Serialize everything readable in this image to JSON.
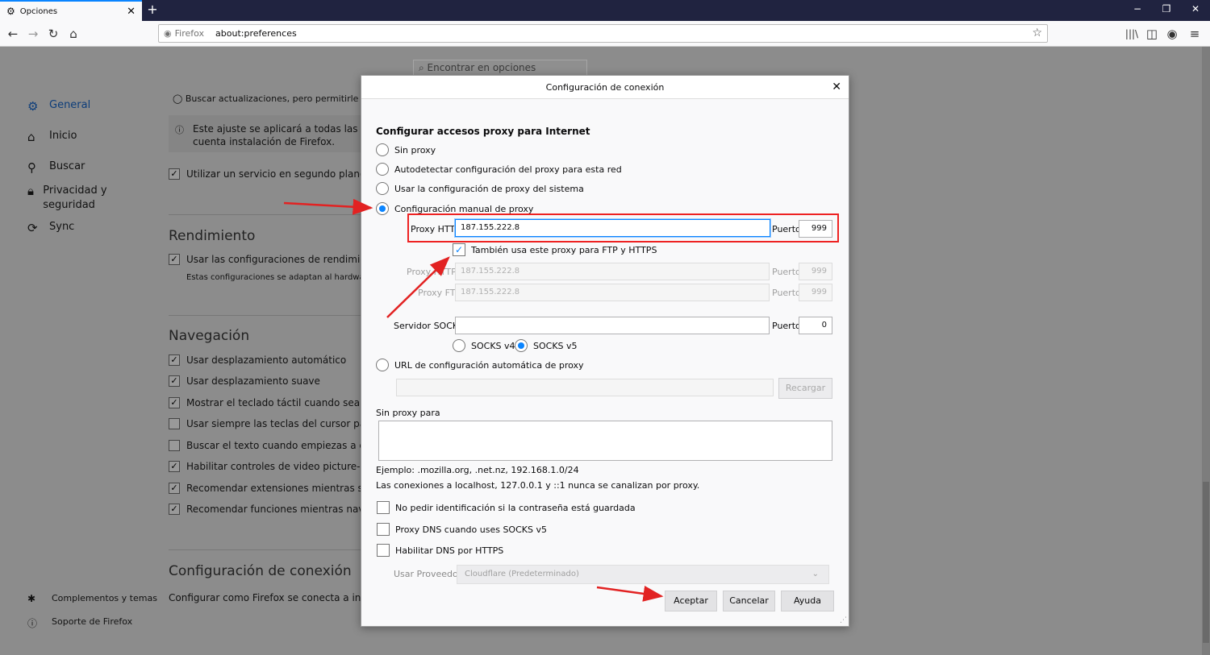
{
  "browser": {
    "tab_title": "Opciones",
    "tab_close": "✕",
    "new_tab": "+",
    "identity_label": "Firefox",
    "url": "about:preferences",
    "window_minimize": "−",
    "window_restore": "❐",
    "window_close": "✕"
  },
  "prefs": {
    "search_placeholder": "Encontrar en opciones",
    "sidebar": [
      {
        "label": "General"
      },
      {
        "label": "Inicio"
      },
      {
        "label": "Buscar"
      },
      {
        "label": "Privacidad y seguridad"
      },
      {
        "label": "Sync"
      }
    ],
    "footer_links": [
      {
        "label": "Complementos y temas"
      },
      {
        "label": "Soporte de Firefox"
      }
    ],
    "update_option": "Buscar actualizaciones, pero permitirle e",
    "update_info": "Este ajuste se aplicará a todas las cuenta instalación de Firefox.",
    "background_service": "Utilizar un servicio en segundo plano para",
    "performance_heading": "Rendimiento",
    "performance_option": "Usar las configuraciones de rendimiento r",
    "performance_note": "Estas configuraciones se adaptan al hardware",
    "navigation_heading": "Navegación",
    "navigation_options": [
      {
        "label": "Usar desplazamiento automático",
        "checked": true
      },
      {
        "label": "Usar desplazamiento suave",
        "checked": true
      },
      {
        "label": "Mostrar el teclado táctil cuando sea neces",
        "checked": true
      },
      {
        "label": "Usar siempre las teclas del cursor para nav",
        "checked": false
      },
      {
        "label": "Buscar el texto cuando empiezas a escribi",
        "checked": false
      },
      {
        "label": "Habilitar controles de video picture-in-pic",
        "checked": true
      },
      {
        "label": "Recomendar extensiones mientras se nave",
        "checked": true
      },
      {
        "label": "Recomendar funciones mientras navegas",
        "checked": true
      }
    ],
    "connection_heading": "Configuración de conexión",
    "connection_text": "Configurar como Firefox se conecta a internet."
  },
  "dialog": {
    "title": "Configuración de conexión",
    "close": "✕",
    "heading": "Configurar accesos proxy para Internet",
    "radio_options": [
      {
        "label": "Sin proxy",
        "selected": false
      },
      {
        "label": "Autodetectar configuración del proxy para esta red",
        "selected": false
      },
      {
        "label": "Usar la configuración de proxy del sistema",
        "selected": false
      },
      {
        "label": "Configuración manual de proxy",
        "selected": true
      }
    ],
    "http_proxy_label": "Proxy HTTP",
    "http_proxy_value": "187.155.222.8",
    "port_label": "Puerto",
    "http_port": "999",
    "also_use_label": "También usa este proxy para FTP y HTTPS",
    "also_use_checked": true,
    "https_proxy_label": "Proxy HTTPS",
    "https_proxy_value": "187.155.222.8",
    "https_port": "999",
    "ftp_proxy_label": "Proxy FTP",
    "ftp_proxy_value": "187.155.222.8",
    "ftp_port": "999",
    "socks_label": "Servidor SOCKS",
    "socks_value": "",
    "socks_port": "0",
    "socks_v4": "SOCKS v4",
    "socks_v5": "SOCKS v5",
    "socks_version_selected": "SOCKS v5",
    "auto_url_label": "URL de configuración automática de proxy",
    "auto_url_value": "",
    "reload_button": "Recargar",
    "no_proxy_label": "Sin proxy para",
    "no_proxy_value": "",
    "example_text": "Ejemplo: .mozilla.org, .net.nz, 192.168.1.0/24",
    "localhost_note": "Las conexiones a localhost, 127.0.0.1 y ::1 nunca se canalizan por proxy.",
    "checkboxes": [
      {
        "label": "No pedir identificación si la contraseña está guardada",
        "checked": false
      },
      {
        "label": "Proxy DNS cuando uses SOCKS v5",
        "checked": false
      },
      {
        "label": "Habilitar DNS por HTTPS",
        "checked": false
      }
    ],
    "provider_label": "Usar Proveedor",
    "provider_value": "Cloudflare (Predeterminado)",
    "accept_button": "Aceptar",
    "cancel_button": "Cancelar",
    "help_button": "Ayuda"
  },
  "colors": {
    "accent": "#0a84ff",
    "annotation_red": "#e22222",
    "titlebar": "#202340"
  },
  "icons": {
    "tab": "gear-icon",
    "back": "back-arrow-icon",
    "forward": "forward-arrow-icon",
    "reload": "reload-icon",
    "home": "home-icon",
    "bookmark": "star-icon"
  }
}
